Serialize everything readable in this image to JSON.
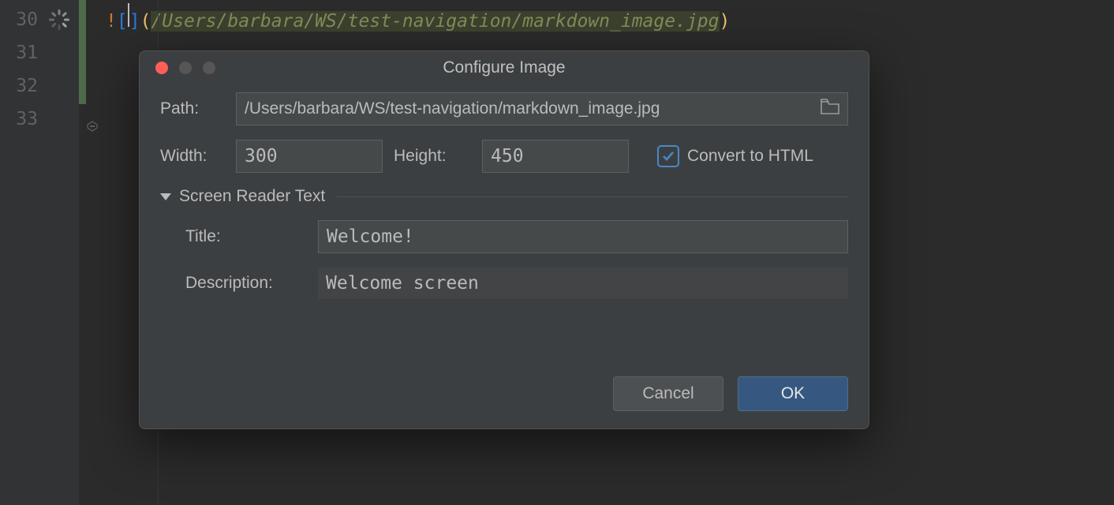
{
  "editor": {
    "lines": [
      "30",
      "31",
      "32",
      "33"
    ],
    "code": {
      "bang": "!",
      "bracket_open": "[",
      "bracket_close": "]",
      "paren_open": "(",
      "path": "/Users/barbara/WS/test-navigation/markdown_image.jpg",
      "paren_close": ")"
    }
  },
  "dialog": {
    "title": "Configure Image",
    "labels": {
      "path": "Path:",
      "width": "Width:",
      "height": "Height:",
      "convert": "Convert to HTML",
      "section": "Screen Reader Text",
      "title_lbl": "Title:",
      "description": "Description:"
    },
    "values": {
      "path": "/Users/barbara/WS/test-navigation/markdown_image.jpg",
      "width": "300",
      "height": "450",
      "convert_checked": true,
      "title": "Welcome!",
      "description": "Welcome screen"
    },
    "buttons": {
      "cancel": "Cancel",
      "ok": "OK"
    }
  }
}
